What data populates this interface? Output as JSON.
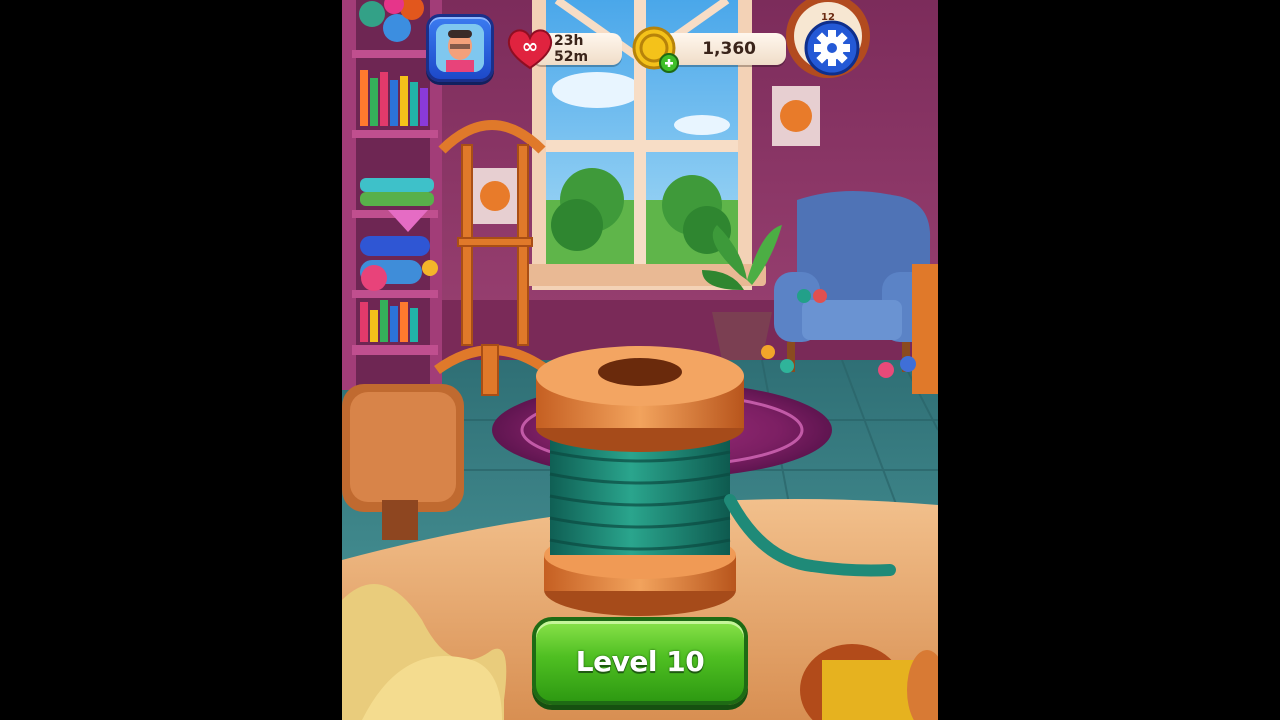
{
  "hud": {
    "lives_timer": "23h 52m",
    "lives_icon": "heart-infinity-icon",
    "coins": "1,360",
    "coin_icon": "coin-plus-icon",
    "settings_icon": "gear-icon",
    "avatar_icon": "player-avatar"
  },
  "level_button": {
    "label": "Level 10"
  },
  "clock_numeral": "12",
  "colors": {
    "wall": "#8c3466",
    "floor": "#3f8b8e",
    "table": "#e8a86b",
    "yarn": "#1f8a78",
    "button_green": "#4fbf22",
    "settings_blue": "#2459d6"
  }
}
